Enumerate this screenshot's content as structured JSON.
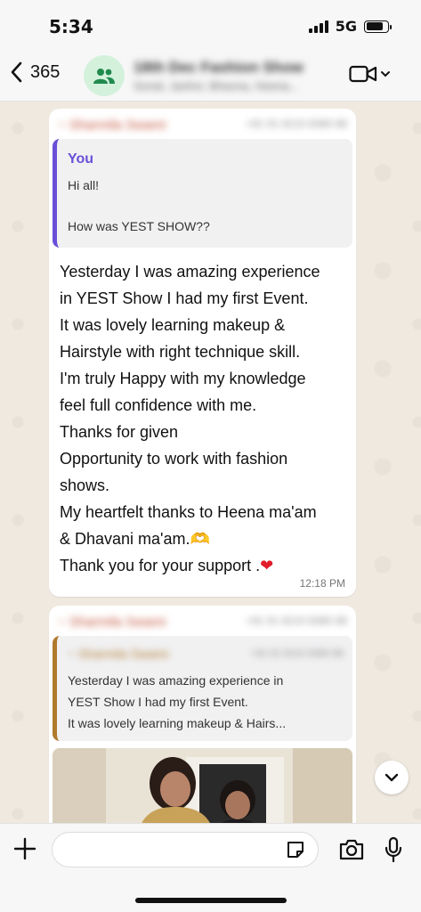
{
  "status_bar": {
    "time": "5:34",
    "network": "5G"
  },
  "header": {
    "back_count": "365",
    "chat_name": "18th Dec Fashion Show",
    "members": "Sonal, Janhvi, Bhavna, Heena..."
  },
  "message1": {
    "sender": "~ Sharmila Swami",
    "sender_phone": "+91 91 8210 8380 88",
    "quote": {
      "author": "You",
      "line1": "Hi all!",
      "line2": "How was YEST SHOW??"
    },
    "lines": [
      "Yesterday I was amazing experience",
      "in YEST Show I had my first Event.",
      "It was lovely learning makeup &",
      "Hairstyle with right technique skill.",
      "I'm truly Happy with my knowledge",
      "feel full confidence with me.",
      "Thanks for given",
      "Opportunity to work with fashion",
      "shows.",
      "My heartfelt thanks to Heena ma'am",
      "& Dhavani ma'am.",
      "Thank you for your support ."
    ],
    "emoji_hands": "🫶",
    "emoji_heart": "❤",
    "time": "12:18 PM"
  },
  "message2": {
    "sender": "~ Sharmila Swami",
    "sender_phone": "+91 91 8210 8380 88",
    "quote": {
      "author": "~ Sharmila Swami",
      "phone": "+91 91 8210 8380 88",
      "line1": "Yesterday I was amazing experience in",
      "line2": "YEST Show I had my first Event.",
      "line3": "It was lovely learning makeup & Hairs..."
    }
  },
  "input": {
    "placeholder": ""
  },
  "colors": {
    "accent_you": "#6a4fd8",
    "quote_bar_2": "#b07a2e",
    "chat_bg": "#efe9e0"
  }
}
